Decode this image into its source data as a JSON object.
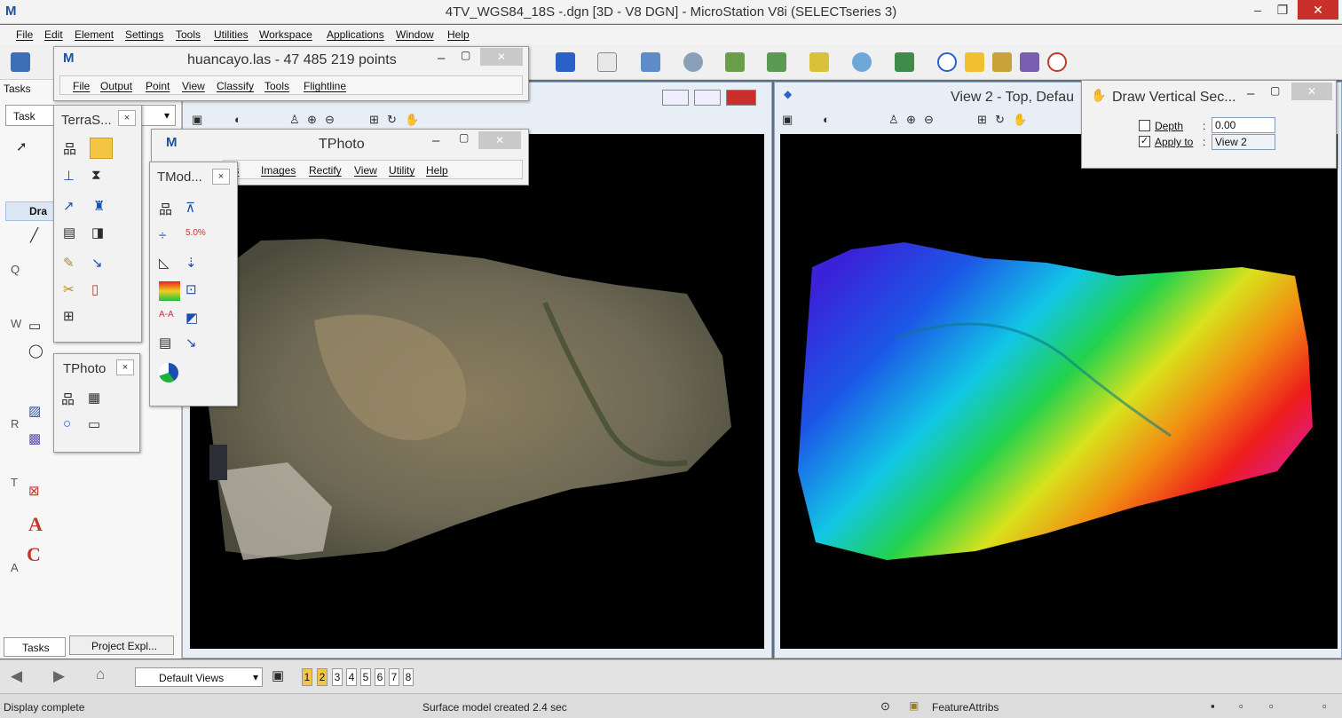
{
  "app": {
    "title": "4TV_WGS84_18S -.dgn [3D - V8 DGN] - MicroStation V8i (SELECTseries 3)",
    "logo": "M",
    "minimize": "–",
    "maximize": "❐",
    "close": "✕"
  },
  "menubar": [
    "File",
    "Edit",
    "Element",
    "Settings",
    "Tools",
    "Utilities",
    "Workspace",
    "Applications",
    "Window",
    "Help"
  ],
  "tasks_panel": {
    "header": "Tasks",
    "dropdown": "Task",
    "section_label": "Dra",
    "row_letters": [
      "Q",
      "W",
      "R",
      "T",
      "A"
    ],
    "tabs": [
      "Tasks",
      "Project Expl..."
    ]
  },
  "terrascan_window": {
    "title": "huancayo.las - 47 485 219 points",
    "menu": [
      "File",
      "Output",
      "Point",
      "View",
      "Classify",
      "Tools",
      "Flightline"
    ]
  },
  "tphoto_window": {
    "title": "TPhoto",
    "menu": [
      "ts",
      "Images",
      "Rectify",
      "View",
      "Utility",
      "Help"
    ]
  },
  "terras_toolbox": {
    "title": "TerraS...",
    "close": "×"
  },
  "tmod_toolbox": {
    "title": "TMod...",
    "close": "×"
  },
  "tphoto_toolbox": {
    "title": "TPhoto",
    "close": "×"
  },
  "view1": {
    "title": ""
  },
  "view2": {
    "title": "View 2 - Top, Defau"
  },
  "draw_vertical_section": {
    "title": "Draw Vertical Sec...",
    "depth_label": "Depth",
    "depth_value": "0.00",
    "depth_checked": false,
    "apply_label": "Apply to",
    "apply_value": "View 2",
    "apply_checked": true
  },
  "viewgroup": {
    "dropdown": "Default Views",
    "views": [
      "1",
      "2",
      "3",
      "4",
      "5",
      "6",
      "7",
      "8"
    ],
    "active": [
      "1",
      "2"
    ]
  },
  "status": {
    "left": "Display complete",
    "message": "Surface model created 2.4 sec",
    "attrib": "FeatureAttribs"
  }
}
